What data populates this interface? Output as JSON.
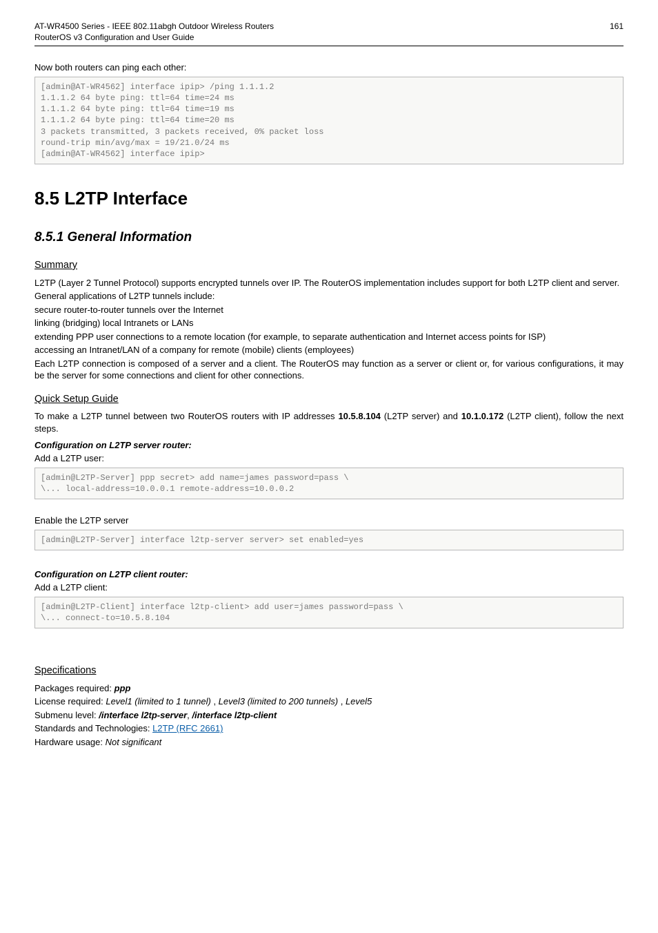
{
  "header": {
    "title_l1": "AT-WR4500 Series - IEEE 802.11abgh Outdoor Wireless Routers",
    "title_l2": "RouterOS v3 Configuration and User Guide",
    "page": "161"
  },
  "intro": {
    "line": "Now both routers can ping each other:"
  },
  "code1": "[admin@AT-WR4562] interface ipip> /ping 1.1.1.2\n1.1.1.2 64 byte ping: ttl=64 time=24 ms\n1.1.1.2 64 byte ping: ttl=64 time=19 ms\n1.1.1.2 64 byte ping: ttl=64 time=20 ms\n3 packets transmitted, 3 packets received, 0% packet loss\nround-trip min/avg/max = 19/21.0/24 ms\n[admin@AT-WR4562] interface ipip>",
  "h1": "8.5 L2TP Interface",
  "h2": "8.5.1 General Information",
  "summary": {
    "heading": "Summary",
    "p1": "L2TP (Layer 2 Tunnel Protocol) supports encrypted tunnels over IP. The RouterOS implementation includes support for both L2TP client and server.",
    "p2": "General applications of L2TP tunnels include:",
    "p3": "secure router-to-router tunnels over the Internet",
    "p4": "linking (bridging) local Intranets or LANs",
    "p5": "extending PPP user connections to a remote location (for example, to separate authentication and Internet access points for ISP)",
    "p6": "accessing an Intranet/LAN of a company for remote (mobile) clients (employees)",
    "p7": "Each L2TP connection is composed of a server and a client. The RouterOS may function as a server or client or, for various configurations, it may be the server for some connections and client for other connections."
  },
  "quick": {
    "heading": "Quick Setup Guide",
    "p_pre": "To make a L2TP tunnel between two RouterOS routers with IP addresses ",
    "ip1": "10.5.8.104",
    "p_mid1": " (L2TP server) and ",
    "ip2": "10.1.0.172",
    "p_mid2": " (L2TP client), follow the next steps.",
    "srv_head": "Configuration on L2TP server router:",
    "srv_line": "Add a L2TP user:",
    "code2": "[admin@L2TP-Server] ppp secret> add name=james password=pass \\\n\\... local-address=10.0.0.1 remote-address=10.0.0.2",
    "enable_line": "Enable the L2TP server",
    "code3": "[admin@L2TP-Server] interface l2tp-server server> set enabled=yes",
    "cli_head": "Configuration on L2TP client router:",
    "cli_line": "Add a L2TP client:",
    "code4": "[admin@L2TP-Client] interface l2tp-client> add user=james password=pass \\\n\\... connect-to=10.5.8.104"
  },
  "specs": {
    "heading": "Specifications",
    "pkg_label": "Packages required: ",
    "pkg_val": "ppp",
    "lic_label": "License required: ",
    "lic_a": "Level1 (limited to 1 tunnel)",
    "lic_b": "Level3 (limited to 200 tunnels)",
    "lic_c": "Level5",
    "sub_label": "Submenu level: ",
    "sub_a": "/interface l2tp-server",
    "sub_b": "/interface l2tp-client",
    "std_label": "Standards and Technologies: ",
    "std_link": "L2TP (RFC 2661)",
    "hw_label": "Hardware usage: ",
    "hw_val": "Not significant"
  }
}
